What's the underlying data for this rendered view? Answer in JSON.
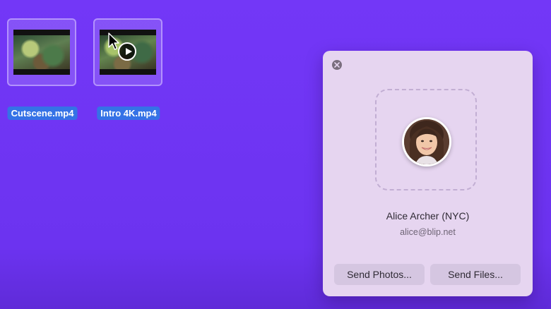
{
  "desktop": {
    "files": [
      {
        "name": "Cutscene.mp4",
        "selected": true
      },
      {
        "name": "Intro 4K.mp4",
        "selected": true
      }
    ]
  },
  "panel": {
    "contact": {
      "name": "Alice Archer (NYC)",
      "email": "alice@blip.net"
    },
    "buttons": {
      "send_photos": "Send Photos...",
      "send_files": "Send Files..."
    }
  },
  "icons": [
    "close-icon",
    "play-icon",
    "pointer-cursor-icon",
    "avatar"
  ],
  "colors": {
    "desktop_background": "#7035f5",
    "panel_background": "#e6d5f0",
    "selection_label": "#3572e6",
    "button_background": "#d5c6e1"
  }
}
